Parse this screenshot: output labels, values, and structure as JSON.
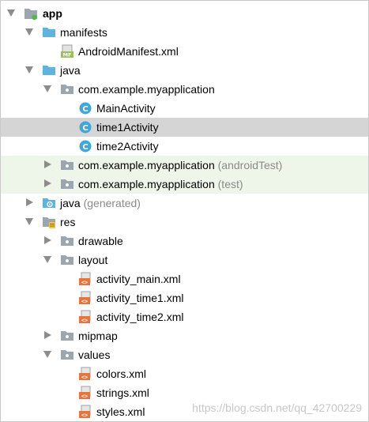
{
  "tree": {
    "app": "app",
    "manifests": "manifests",
    "android_manifest": "AndroidManifest.xml",
    "java": "java",
    "pkg_main": "com.example.myapplication",
    "main_activity": "MainActivity",
    "time1_activity": "time1Activity",
    "time2_activity": "time2Activity",
    "pkg_android_test": "com.example.myapplication",
    "pkg_android_test_suffix": "(androidTest)",
    "pkg_test": "com.example.myapplication",
    "pkg_test_suffix": "(test)",
    "java_generated": "java",
    "java_generated_suffix": "(generated)",
    "res": "res",
    "drawable": "drawable",
    "layout": "layout",
    "activity_main_xml": "activity_main.xml",
    "activity_time1_xml": "activity_time1.xml",
    "activity_time2_xml": "activity_time2.xml",
    "mipmap": "mipmap",
    "values": "values",
    "colors_xml": "colors.xml",
    "strings_xml": "strings.xml",
    "styles_xml": "styles.xml"
  },
  "icons": {
    "folder": "folder-icon",
    "package": "package-folder-icon",
    "class": "java-class-icon",
    "xml_layout": "xml-file-icon",
    "manifest": "manifest-file-icon",
    "module": "module-icon"
  },
  "colors": {
    "selected_row": "#d5d5d5",
    "test_row": "#eef6e9",
    "folder_blue": "#5fb3e0",
    "package_gray": "#9aa7b0",
    "class_blue": "#40a8d8",
    "xml_orange": "#e8743b"
  },
  "watermark": "https://blog.csdn.net/qq_42700229"
}
